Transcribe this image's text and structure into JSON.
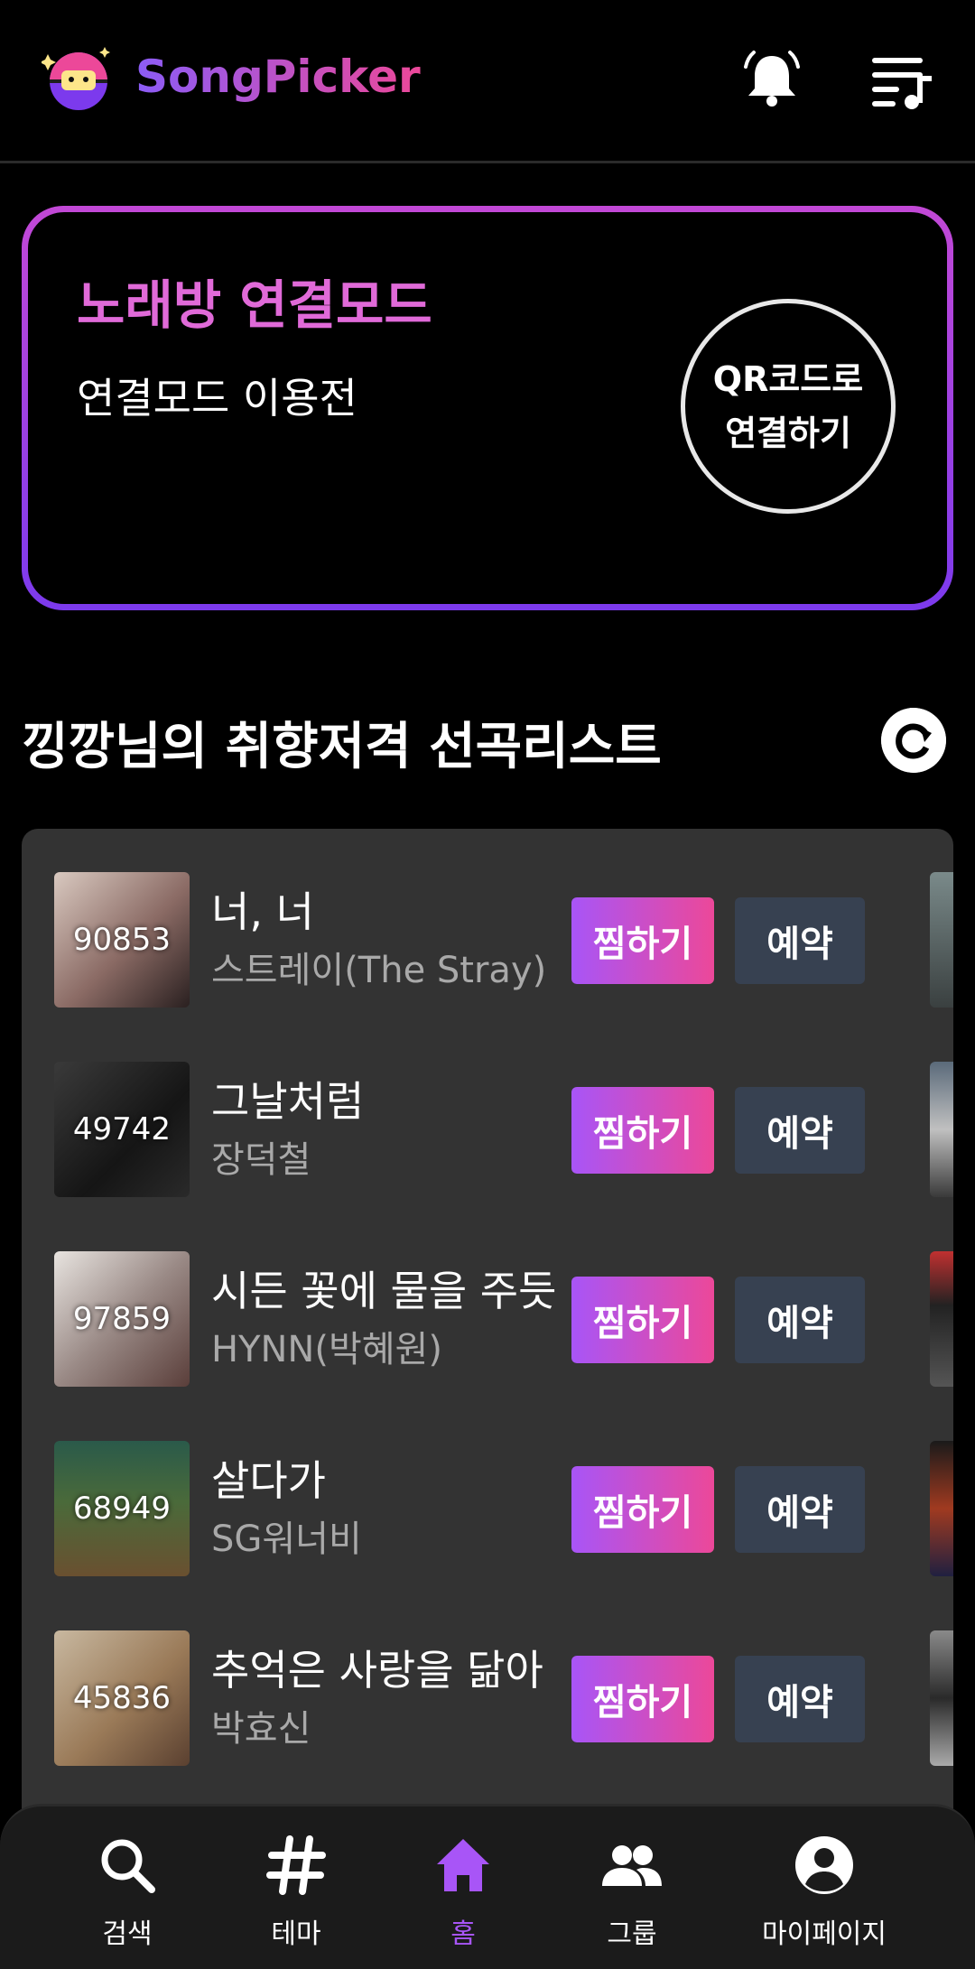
{
  "header": {
    "brand": "SongPicker",
    "icons": [
      "disco-ball-logo-icon",
      "bell-icon",
      "playlist-icon"
    ]
  },
  "connect": {
    "title": "노래방 연결모드",
    "status": "연결모드 이용전",
    "qr_line1": "QR코드로",
    "qr_line2": "연결하기"
  },
  "recommend": {
    "title": "낑깡님의 취향저격 선곡리스트",
    "refresh_icon": "refresh-icon"
  },
  "buttons": {
    "dib": "찜하기",
    "reserve": "예약"
  },
  "songs": [
    {
      "code": "90853",
      "title": "너, 너",
      "artist": "스트레이(The Stray)"
    },
    {
      "code": "49742",
      "title": "그날처럼",
      "artist": "장덕철"
    },
    {
      "code": "97859",
      "title": "시든 꽃에 물을 주듯",
      "artist": "HYNN(박혜원)"
    },
    {
      "code": "68949",
      "title": "살다가",
      "artist": "SG워너비"
    },
    {
      "code": "45836",
      "title": "추억은 사랑을 닮아",
      "artist": "박효신"
    }
  ],
  "nav": {
    "active": "홈",
    "items": [
      {
        "label": "검색",
        "icon": "search-icon"
      },
      {
        "label": "테마",
        "icon": "hashtag-icon"
      },
      {
        "label": "홈",
        "icon": "home-icon"
      },
      {
        "label": "그룹",
        "icon": "group-icon"
      },
      {
        "label": "마이페이지",
        "icon": "account-icon"
      }
    ]
  },
  "colors": {
    "accent_purple": "#a855f7",
    "accent_pink": "#ec4899",
    "reserve_bg": "#374151",
    "list_bg": "#333333"
  }
}
